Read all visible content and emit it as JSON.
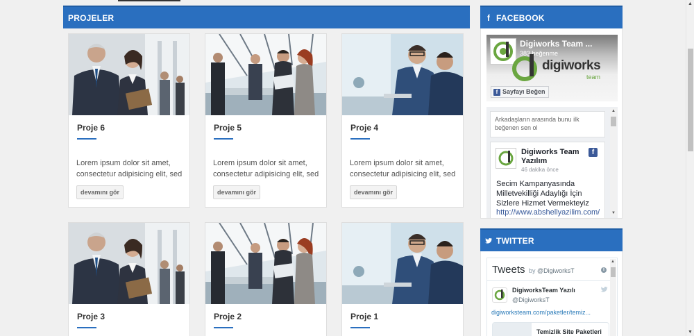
{
  "projects": {
    "heading": "PROJELER",
    "cards": [
      {
        "title": "Proje 6",
        "desc": "Lorem ipsum dolor sit amet, consectetur adipisicing elit, sed",
        "more": "devamını gör",
        "image": "business-meeting-photo"
      },
      {
        "title": "Proje 5",
        "desc": "Lorem ipsum dolor sit amet, consectetur adipisicing elit, sed",
        "more": "devamını gör",
        "image": "office-team-photo"
      },
      {
        "title": "Proje 4",
        "desc": "Lorem ipsum dolor sit amet, consectetur adipisicing elit, sed",
        "more": "devamını gör",
        "image": "laptop-meeting-photo"
      },
      {
        "title": "Proje 3",
        "image": "business-meeting-photo"
      },
      {
        "title": "Proje 2",
        "image": "office-team-photo"
      },
      {
        "title": "Proje 1",
        "image": "laptop-meeting-photo"
      }
    ]
  },
  "facebook": {
    "heading": "FACEBOOK",
    "icon": "facebook-icon",
    "page_name": "Digiworks Team ...",
    "likes": "383 beğenme",
    "brand": "digiworks",
    "brand_sub": "team",
    "like_button": "Sayfayı Beğen",
    "friends_text": "Arkadaşların arasında bunu ilk beğenen sen ol",
    "post": {
      "author": "Digiworks Team Yazılım",
      "time": "46 dakika önce",
      "text": "Secim Kampanyasında Milletvekilliği Adaylığı İçin Sizlere Hizmet Vermekteyiz",
      "link": "http://www.abshellyazilim.com/"
    }
  },
  "twitter": {
    "heading": "TWITTER",
    "icon": "twitter-bird-icon",
    "title": "Tweets",
    "by": "by",
    "handle_link": "@DigiworksT",
    "tweet": {
      "name": "DigiworksTeam Yazılı",
      "handle": "@DigiworksT",
      "link": "digiworksteam.com/paketler/temiz...",
      "card_title": "Temizlik Site Paketleri"
    }
  },
  "colors": {
    "accent": "#2a6fbf",
    "facebook": "#3b5998",
    "logo_green": "#6aa640"
  }
}
